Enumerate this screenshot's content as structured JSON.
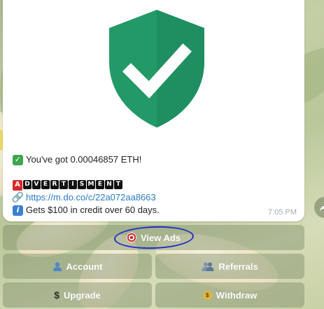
{
  "message": {
    "line1": "You've got 0.00046857 ETH!",
    "ad_first_letter": "A",
    "ad_rest_letters": [
      "D",
      "V",
      "E",
      "R",
      "T",
      "I",
      "S",
      "M",
      "E",
      "N",
      "T"
    ],
    "link_text": "https://m.do.co/c/22a072aa8663",
    "credit_text": "Gets $100 in credit over 60 days.",
    "time": "7:05 PM"
  },
  "colors": {
    "shield": "#239968",
    "annotation_circle": "#1f2fc7",
    "link": "#2b7bc0"
  },
  "icons": {
    "shield": "shield-check-icon",
    "check": "check-mark-button-icon",
    "link": "link-icon",
    "info": "information-icon",
    "view_ads": "direct-hit-target-icon",
    "account": "bust-in-silhouette-icon",
    "referrals": "busts-in-silhouette-icon",
    "upgrade": "dollar-sign-icon",
    "withdraw": "money-bag-icon",
    "share": "share-arrow-icon"
  },
  "keyboard": {
    "view_ads": "View Ads",
    "account": "Account",
    "referrals": "Referrals",
    "upgrade": "Upgrade",
    "withdraw": "Withdraw"
  }
}
